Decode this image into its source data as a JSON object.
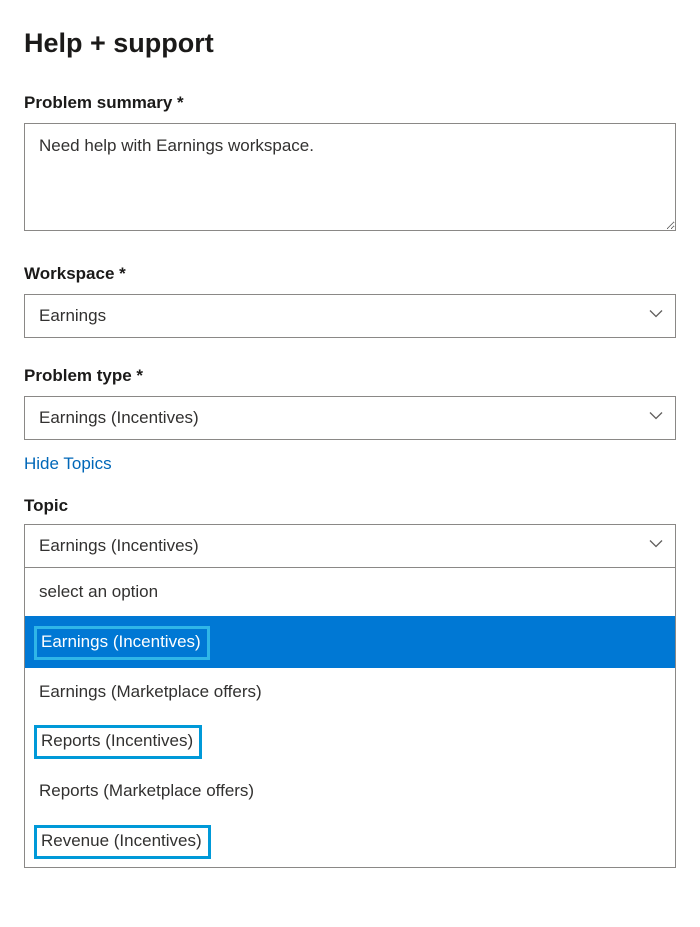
{
  "title": "Help + support",
  "problem_summary": {
    "label": "Problem summary *",
    "value": "Need help with Earnings workspace."
  },
  "workspace": {
    "label": "Workspace *",
    "value": "Earnings"
  },
  "problem_type": {
    "label": "Problem type *",
    "value": "Earnings (Incentives)"
  },
  "hide_topics_link": "Hide Topics",
  "topic": {
    "label": "Topic",
    "value": "Earnings (Incentives)",
    "placeholder_option": "select an option",
    "options": [
      {
        "label": "Earnings (Incentives)",
        "selected": true,
        "highlight": true
      },
      {
        "label": "Earnings (Marketplace offers)",
        "selected": false,
        "highlight": false
      },
      {
        "label": "Reports (Incentives)",
        "selected": false,
        "highlight": true
      },
      {
        "label": "Reports (Marketplace offers)",
        "selected": false,
        "highlight": false
      },
      {
        "label": "Revenue (Incentives)",
        "selected": false,
        "highlight": true
      }
    ]
  },
  "colors": {
    "accent": "#0078d4",
    "link": "#0067b8",
    "highlight_border": "#0099d8"
  }
}
